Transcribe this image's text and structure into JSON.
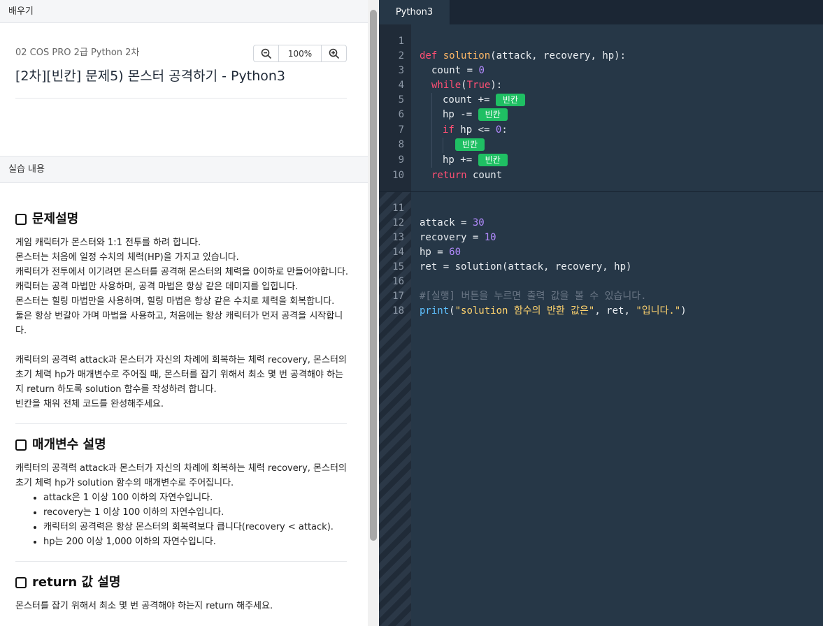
{
  "left": {
    "header_label": "배우기",
    "breadcrumb": "02 COS PRO 2급 Python 2차",
    "zoom_value": "100%",
    "title": "[2차][빈칸] 문제5) 몬스터 공격하기 - Python3",
    "practice_label": "실습 내용",
    "sections": {
      "problem": {
        "heading": "문제설명",
        "lines": [
          "게임 캐릭터가 몬스터와 1:1 전투를 하려 합니다.",
          "몬스터는 처음에 일정 수치의 체력(HP)을 가지고 있습니다.",
          "캐릭터가 전투에서 이기려면 몬스터를 공격해 몬스터의 체력을 0이하로 만들어야합니다.",
          "캐릭터는 공격 마법만 사용하며, 공격 마법은 항상 같은 데미지를 입힙니다.",
          "몬스터는 힐링 마법만을 사용하며, 힐링 마법은 항상 같은 수치로 체력을 회복합니다.",
          "둘은 항상 번갈아 가며 마법을 사용하고, 처음에는 항상 캐릭터가 먼저 공격을 시작합니다."
        ],
        "para2": "캐릭터의 공격력 attack과 몬스터가 자신의 차례에 회복하는 체력 recovery, 몬스터의 초기 체력 hp가 매개변수로 주어질 때, 몬스터를 잡기 위해서 최소 몇 번 공격해야 하는지 return 하도록 solution 함수를 작성하려 합니다.",
        "para3": "빈칸을 채워 전체 코드를 완성해주세요."
      },
      "params": {
        "heading": "매개변수 설명",
        "intro": "캐릭터의 공격력 attack과 몬스터가 자신의 차례에 회복하는 체력 recovery, 몬스터의 초기 체력 hp가 solution 함수의 매개변수로 주어집니다.",
        "items": [
          "attack은 1 이상 100 이하의 자연수입니다.",
          "recovery는 1 이상 100 이하의 자연수입니다.",
          "캐릭터의 공격력은 항상 몬스터의 회복력보다 큽니다(recovery < attack).",
          "hp는 200 이상 1,000 이하의 자연수입니다."
        ]
      },
      "return": {
        "heading": "return 값 설명",
        "text": "몬스터를 잡기 위해서 최소 몇 번 공격해야 하는지 return 해주세요."
      }
    }
  },
  "editor": {
    "tab_label": "Python3",
    "blank_label": "빈칸",
    "line_numbers": [
      "1",
      "2",
      "3",
      "4",
      "5",
      "6",
      "7",
      "8",
      "9",
      "10",
      "11",
      "12",
      "13",
      "14",
      "15",
      "16",
      "17",
      "18"
    ],
    "code": {
      "l2_def": "def",
      "l2_fn": "solution",
      "l2_rest": "(attack, recovery, hp):",
      "l3_a": "count = ",
      "l3_num": "0",
      "l4_kw": "while",
      "l4_a": "(",
      "l4_true": "True",
      "l4_b": "):",
      "l5_a": "count += ",
      "l6_a": "hp -= ",
      "l7_kw": "if",
      "l7_a": " hp <= ",
      "l7_num": "0",
      "l7_b": ":",
      "l9_a": "hp += ",
      "l10_kw": "return",
      "l10_a": " count",
      "l12_a": "attack = ",
      "l12_num": "30",
      "l13_a": "recovery = ",
      "l13_num": "10",
      "l14_a": "hp = ",
      "l14_num": "60",
      "l15": "ret = solution(attack, recovery, hp)",
      "l17": "#[실행] 버튼을 누르면 출력 값을 볼 수 있습니다.",
      "l18_fn": "print",
      "l18_a": "(",
      "l18_s1": "\"solution 함수의 반환 값은\"",
      "l18_b": ", ret, ",
      "l18_s2": "\"입니다.\"",
      "l18_c": ")"
    }
  }
}
